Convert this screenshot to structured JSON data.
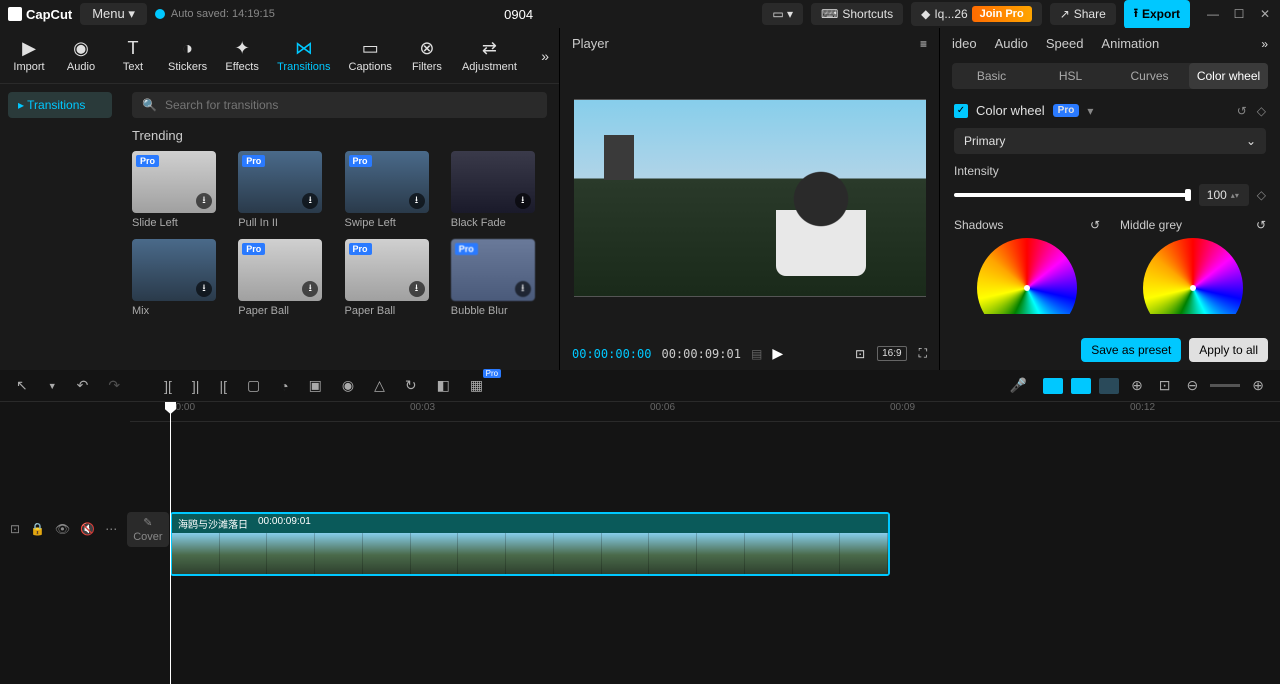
{
  "app": {
    "name": "CapCut",
    "menu": "Menu ▾",
    "autosave": "Auto saved: 14:19:15",
    "project": "0904"
  },
  "topbar": {
    "shortcuts": "Shortcuts",
    "user": "Iq...26",
    "join_pro": "Join Pro",
    "share": "Share",
    "export": "Export"
  },
  "tools": {
    "import": "Import",
    "audio": "Audio",
    "text": "Text",
    "stickers": "Stickers",
    "effects": "Effects",
    "transitions": "Transitions",
    "captions": "Captions",
    "filters": "Filters",
    "adjustment": "Adjustment"
  },
  "sidebar": {
    "transitions": "▸ Transitions"
  },
  "search": {
    "placeholder": "Search for transitions"
  },
  "section": {
    "trending": "Trending"
  },
  "thumbs": [
    {
      "label": "Slide Left",
      "pro": true
    },
    {
      "label": "Pull In II",
      "pro": true
    },
    {
      "label": "Swipe Left",
      "pro": true
    },
    {
      "label": "Black Fade",
      "pro": false
    },
    {
      "label": "Mix",
      "pro": false
    },
    {
      "label": "Paper Ball",
      "pro": true
    },
    {
      "label": "Paper Ball",
      "pro": true
    },
    {
      "label": "Bubble Blur",
      "pro": true
    }
  ],
  "player": {
    "title": "Player",
    "current": "00:00:00:00",
    "duration": "00:00:09:01",
    "ratio": "16:9"
  },
  "rp": {
    "tabs": {
      "video": "ideo",
      "audio": "Audio",
      "speed": "Speed",
      "animation": "Animation"
    },
    "subtabs": {
      "basic": "Basic",
      "hsl": "HSL",
      "curves": "Curves",
      "colorwheel": "Color wheel"
    },
    "cw_title": "Color wheel",
    "pro": "Pro",
    "primary": "Primary",
    "intensity_label": "Intensity",
    "intensity_value": "100",
    "shadows": "Shadows",
    "midgrey": "Middle grey",
    "save_preset": "Save as preset",
    "apply_all": "Apply to all"
  },
  "timeline": {
    "marks": [
      "00:00",
      "00:03",
      "00:06",
      "00:09",
      "00:12"
    ],
    "clip_name": "海鸥与沙滩落日",
    "clip_dur": "00:00:09:01",
    "cover": "Cover"
  }
}
